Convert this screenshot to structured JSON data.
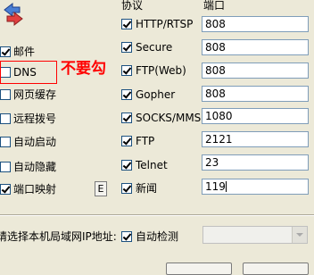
{
  "header": {
    "protocol": "协议",
    "port": "端口"
  },
  "left_options": [
    {
      "label": "邮件",
      "checked": true
    },
    {
      "label": "DNS",
      "checked": false
    },
    {
      "label": "网页缓存",
      "checked": false
    },
    {
      "label": "远程拨号",
      "checked": false
    },
    {
      "label": "自动启动",
      "checked": false
    },
    {
      "label": "自动隐藏",
      "checked": false
    },
    {
      "label": "端口映射",
      "checked": true
    }
  ],
  "annotation": "不要勾",
  "e_button": "E",
  "protocols": [
    {
      "name": "HTTP/RTSP",
      "port": "808",
      "checked": true
    },
    {
      "name": "Secure",
      "port": "808",
      "checked": true
    },
    {
      "name": "FTP(Web)",
      "port": "808",
      "checked": true
    },
    {
      "name": "Gopher",
      "port": "808",
      "checked": true
    },
    {
      "name": "SOCKS/MMS",
      "port": "1080",
      "checked": true
    },
    {
      "name": "FTP",
      "port": "2121",
      "checked": true
    },
    {
      "name": "Telnet",
      "port": "23",
      "checked": true
    },
    {
      "name": "新闻",
      "port": "119",
      "checked": true
    }
  ],
  "footer": {
    "ip_label": "请选择本机局域网IP地址:",
    "auto_detect": "自动检测",
    "auto_detect_checked": true
  },
  "colors": {
    "annotation_red": "#ff0000",
    "background": "#ece9d8"
  }
}
